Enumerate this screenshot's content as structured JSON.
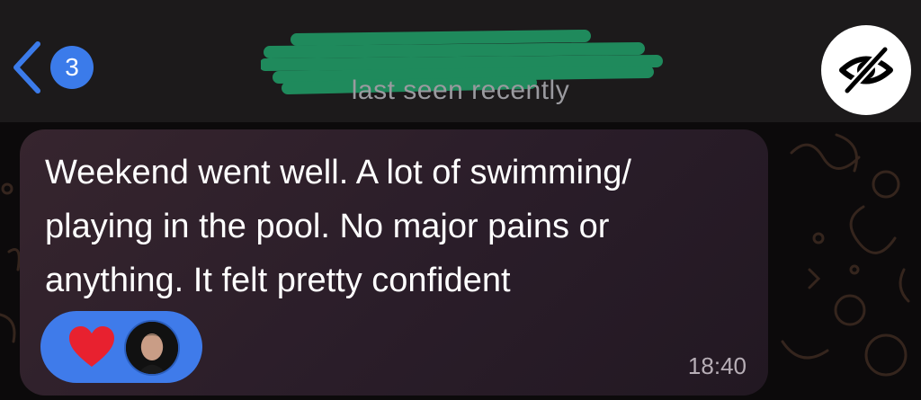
{
  "header": {
    "unread_count": "3",
    "contact_name": "",
    "status": "last seen recently"
  },
  "message": {
    "lines": [
      "Weekend went well. A lot of swimming/",
      "playing in the pool. No major pains or",
      "anything. It felt pretty confident"
    ],
    "time": "18:40",
    "reaction": {
      "emoji": "heart-icon",
      "count_shown_by": "avatar"
    }
  },
  "colors": {
    "accent": "#3b7bea",
    "header_bg": "#1c1a1b",
    "bubble_bg": "#2c1f2a",
    "redaction": "#1f8a5c",
    "heart": "#e8212f"
  }
}
